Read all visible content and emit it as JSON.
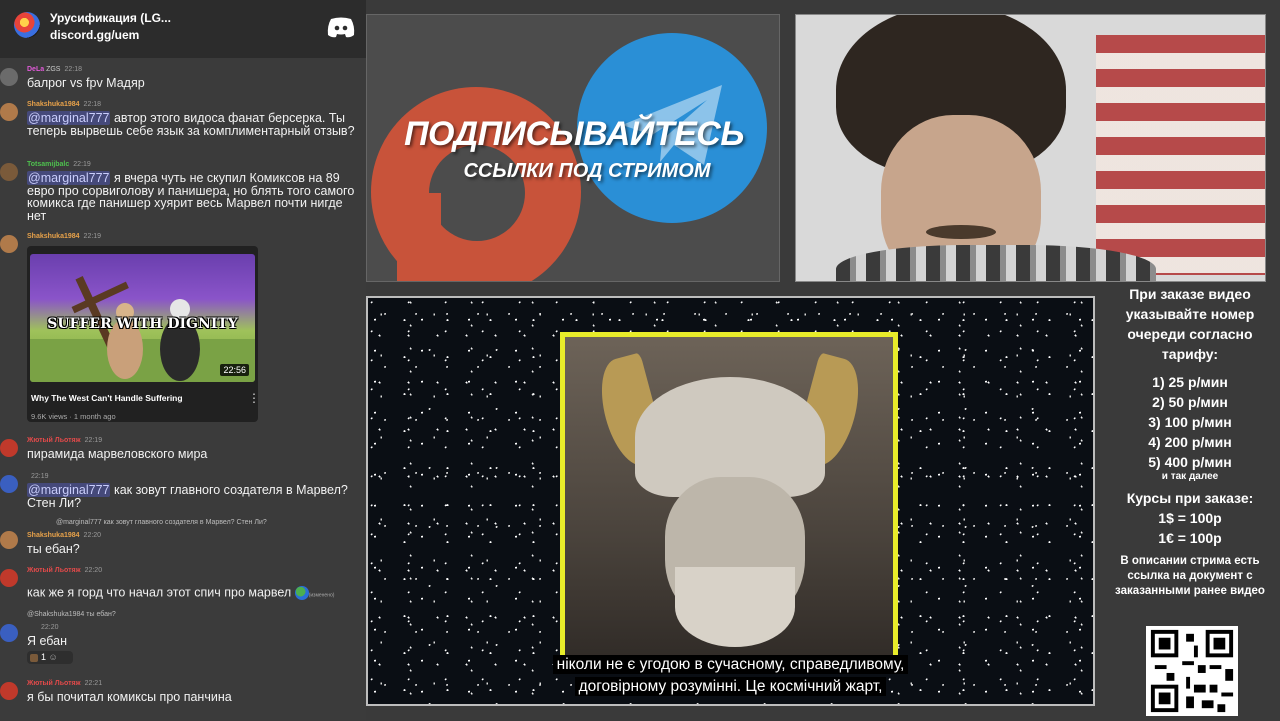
{
  "chat_header": {
    "server_name": "Урусификация (LG...",
    "invite_link": "discord.gg/uem",
    "icon": "discord-icon"
  },
  "messages": [
    {
      "user": "DeLa",
      "badge": "ZGS",
      "time": "22:18",
      "text": "балрог vs fpv Мадяр",
      "user_color": "#e05ad8"
    },
    {
      "user": "Shakshuka1984",
      "time": "22:18",
      "mention": "@marginal777",
      "text": " автор этого видоса фанат берсерка. Ты теперь вырвешь себе язык за комплиментарный отзыв?",
      "user_color": "#e8a24a"
    },
    {
      "user": "Totsamijbalc",
      "time": "22:19",
      "mention": "@marginal777",
      "text": " я вчера чуть не скупил Комиксов на 89 евро про сорвиголову и панишера, но блять того самого комикса где панишер хуярит весь Марвел почти нигде нет",
      "user_color": "#4ec14e"
    },
    {
      "user": "Shakshuka1984",
      "time": "22:19",
      "user_color": "#e8a24a"
    },
    {
      "user": "Жютый Льотяж",
      "time": "22:19",
      "text": "пирамида марвеловского мира",
      "user_color": "#e24a4a"
    },
    {
      "user": "",
      "time": "22:19",
      "mention": "@marginal777",
      "text": " как зовут главного создателя в Марвел? Стен Ли?",
      "user_color": "#9a7ad8"
    },
    {
      "reply": "@marginal777 как зовут главного создателя в Марвел? Стен Ли?",
      "user": "Shakshuka1984",
      "time": "22:20",
      "text": "ты ебан?",
      "user_color": "#e8a24a"
    },
    {
      "user": "Жютый Льотяж",
      "time": "22:20",
      "text": "как же я горд что начал этот спич про марвел",
      "emoji_note": "(измененo)",
      "user_color": "#e24a4a"
    },
    {
      "reply": "@Shakshuka1984 ты ебан?",
      "user": "",
      "time": "22:20",
      "text": "Я ебан",
      "reaction_count": "1",
      "user_color": "#9a7ad8"
    },
    {
      "user": "Жютый Льотяж",
      "time": "22:21",
      "text": "я бы почитал комиксы про панчина",
      "user_color": "#e24a4a"
    }
  ],
  "youtube_card": {
    "thumbnail_caption": "SUFFER WITH DIGNITY",
    "duration": "22:56",
    "title": "Why The West Can't Handle Suffering",
    "meta": "9.6K views · 1 month ago"
  },
  "promo": {
    "title": "ПОДПИСЫВАЙТЕСЬ",
    "subtitle": "ССЫЛКИ ПОД СТРИМОМ"
  },
  "video": {
    "subtitle_line1": "ніколи не є угодою в сучасному, справедливому,",
    "subtitle_line2": "договірному розумінні.  Це космічний жарт,"
  },
  "info": {
    "order_note": "При заказе видео указывайте номер очереди согласно тарифу:",
    "tariffs": [
      "1) 25 р/мин",
      "2) 50 р/мин",
      "3) 100 р/мин",
      "4) 200 р/мин",
      "5) 400 р/мин"
    ],
    "and_so_on": "и так далее",
    "rates_title": "Курсы при заказе:",
    "rate_usd": "1$ = 100р",
    "rate_eur": "1€ = 100р",
    "description_note": "В описании стрима есть ссылка на документ с заказанными ранее видео"
  },
  "colors": {
    "telegram": "#2a8fd6",
    "patreon": "#c8533a",
    "frame_yellow": "#e8ec2a"
  }
}
